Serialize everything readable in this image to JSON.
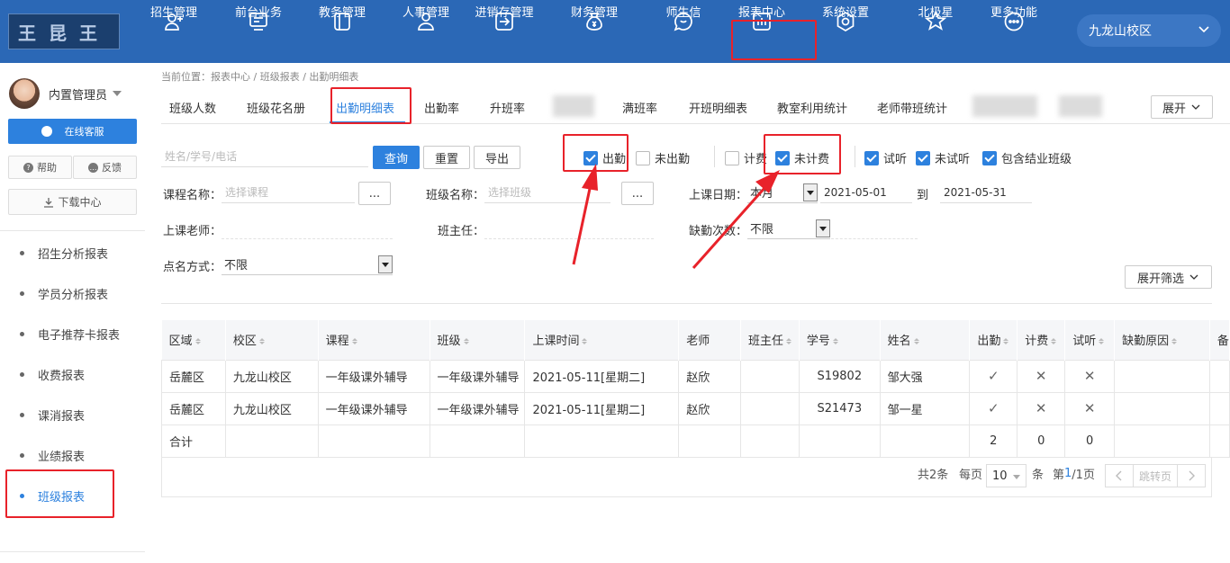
{
  "nav": {
    "school": "九龙山校区",
    "items": [
      {
        "label": "招生管理",
        "icon": "user-add-icon"
      },
      {
        "label": "前台业务",
        "icon": "monitor-icon"
      },
      {
        "label": "教务管理",
        "icon": "book-icon"
      },
      {
        "label": "人事管理",
        "icon": "person-icon"
      },
      {
        "label": "进销存管理",
        "icon": "inout-icon"
      },
      {
        "label": "财务管理",
        "icon": "money-bag-icon"
      },
      {
        "label": "师生信",
        "icon": "message-icon"
      },
      {
        "label": "报表中心",
        "icon": "report-icon"
      },
      {
        "label": "系统设置",
        "icon": "settings-icon"
      },
      {
        "label": "北极星",
        "icon": "star-icon"
      },
      {
        "label": "更多功能",
        "icon": "more-icon"
      }
    ]
  },
  "sidebar": {
    "user_name": "内置管理员",
    "online_service": "在线客服",
    "help": "帮助",
    "feedback": "反馈",
    "download": "下载中心",
    "menu": [
      "招生分析报表",
      "学员分析报表",
      "电子推荐卡报表",
      "收费报表",
      "课消报表",
      "业绩报表",
      "班级报表"
    ]
  },
  "breadcrumb": "当前位置：报表中心 / 班级报表 / 出勤明细表",
  "tabs": [
    "班级人数",
    "班级花名册",
    "出勤明细表",
    "出勤率",
    "升班率",
    "满班率",
    "开班明细表",
    "教室利用统计",
    "老师带班统计"
  ],
  "expand_label": "展开",
  "filters": {
    "search_placeholder": "姓名/学号/电话",
    "query": "查询",
    "reset": "重置",
    "export": "导出",
    "checkboxes": [
      {
        "label": "出勤",
        "checked": true
      },
      {
        "label": "未出勤",
        "checked": false
      },
      {
        "label": "计费",
        "checked": false
      },
      {
        "label": "未计费",
        "checked": true
      },
      {
        "label": "试听",
        "checked": true
      },
      {
        "label": "未试听",
        "checked": true
      },
      {
        "label": "包含结业班级",
        "checked": true
      }
    ],
    "course_label": "课程名称：",
    "course_placeholder": "选择课程",
    "class_label": "班级名称：",
    "class_placeholder": "选择班级",
    "ellipsis": "...",
    "date_label": "上课日期：",
    "date_range_type": "本月",
    "date_from": "2021-05-01",
    "date_to_sep": "到",
    "date_to": "2021-05-31",
    "teacher_label": "上课老师：",
    "head_teacher_label": "班主任：",
    "absence_label": "缺勤次数：",
    "absence_value": "不限",
    "rollcall_label": "点名方式：",
    "rollcall_value": "不限",
    "expand_filter": "展开筛选"
  },
  "table": {
    "headers": [
      "区域",
      "校区",
      "课程",
      "班级",
      "上课时间",
      "老师",
      "班主任",
      "学号",
      "姓名",
      "出勤",
      "计费",
      "试听",
      "缺勤原因",
      "备"
    ],
    "rows": [
      [
        "岳麓区",
        "九龙山校区",
        "一年级课外辅导",
        "一年级课外辅导",
        "2021-05-11[星期二]",
        "赵欣",
        "",
        "S19802",
        "邹大强",
        "✓",
        "✕",
        "✕",
        ""
      ],
      [
        "岳麓区",
        "九龙山校区",
        "一年级课外辅导",
        "一年级课外辅导",
        "2021-05-11[星期二]",
        "赵欣",
        "",
        "S21473",
        "邹一星",
        "✓",
        "✕",
        "✕",
        ""
      ]
    ],
    "total_row": [
      "合计",
      "",
      "",
      "",
      "",
      "",
      "",
      "",
      "",
      "2",
      "0",
      "0",
      ""
    ]
  },
  "pager": {
    "total": "共2条",
    "per_page_label": "每页",
    "per_page": "10",
    "unit": "条",
    "page_prefix": "第",
    "current": "1",
    "page_suffix": "/1页",
    "jump": "跳转页"
  }
}
